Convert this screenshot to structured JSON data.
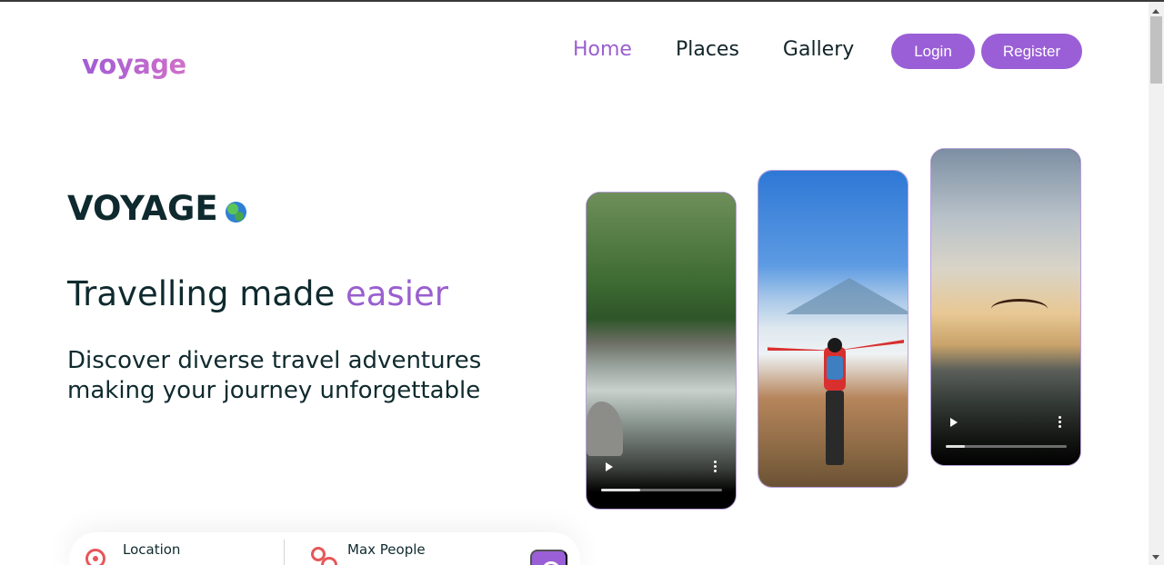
{
  "header": {
    "logo": "voyage",
    "nav": [
      {
        "label": "Home",
        "active": true
      },
      {
        "label": "Places",
        "active": false
      },
      {
        "label": "Gallery",
        "active": false
      }
    ],
    "login_label": "Login",
    "register_label": "Register"
  },
  "hero": {
    "brand": "VOYAGE",
    "brand_icon": "globe-icon",
    "tagline_main": "Travelling made ",
    "tagline_accent": "easier",
    "subtitle": "Discover diverse travel adventures making your journey unforgettable"
  },
  "videos": [
    {
      "scene": "river rapids",
      "progress": 0.32
    },
    {
      "scene": "hiker on mountain above clouds",
      "progress": null
    },
    {
      "scene": "paraglider at sunset",
      "progress": 0.16
    }
  ],
  "search": {
    "location_label": "Location",
    "people_label": "Max People"
  },
  "colors": {
    "accent": "#9a5fd6",
    "text": "#0f2a2e",
    "icon_red": "#e6575a"
  }
}
